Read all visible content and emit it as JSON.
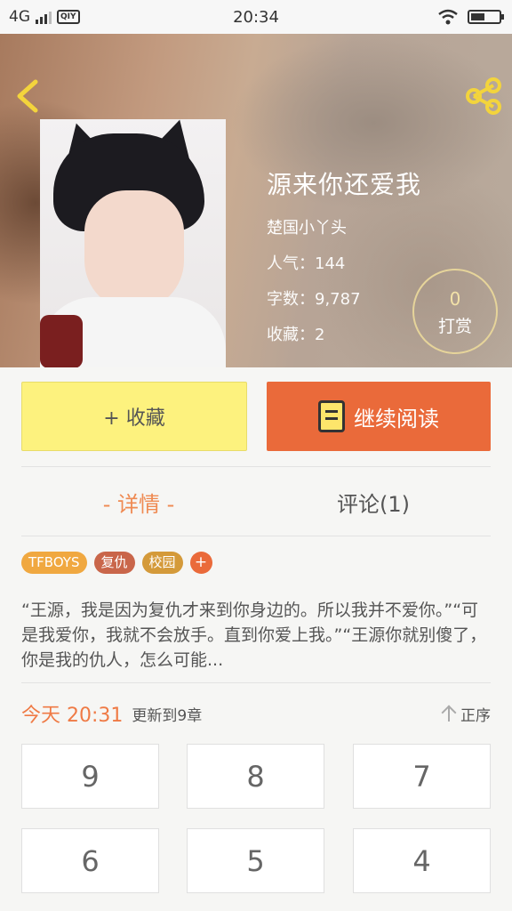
{
  "status": {
    "network": "4G",
    "app_badge": "QIY",
    "time": "20:34"
  },
  "book": {
    "title": "源来你还爱我",
    "author": "楚国小丫头",
    "popularity_label": "人气：",
    "popularity": "144",
    "words_label": "字数：",
    "words": "9,787",
    "favorites_label": "收藏：",
    "favorites": "2"
  },
  "tip": {
    "count": "0",
    "label": "打赏"
  },
  "actions": {
    "favorite": "+ 收藏",
    "read": "继续阅读"
  },
  "tabs": [
    {
      "label": "- 详情 -"
    },
    {
      "label": "评论(1)"
    }
  ],
  "tags": [
    {
      "label": "TFBOYS",
      "color": "#f0a840"
    },
    {
      "label": "复仇",
      "color": "#c9664a"
    },
    {
      "label": "校园",
      "color": "#d49a3a"
    },
    {
      "label": "+",
      "color": "#ea6a3a"
    }
  ],
  "summary": "“王源，我是因为复仇才来到你身边的。所以我并不爱你。”“可是我爱你，我就不会放手。直到你爱上我。”“王源你就别傻了，你是我的仇人，怎么可能...",
  "update": {
    "today": "今天 20:31",
    "text": "更新到9章",
    "order": "正序"
  },
  "chapters": [
    "9",
    "8",
    "7",
    "6",
    "5",
    "4"
  ],
  "colors": {
    "accent": "#ea6a3a",
    "fav_bg": "#fdf27e",
    "active_tab": "#ef8a52"
  }
}
